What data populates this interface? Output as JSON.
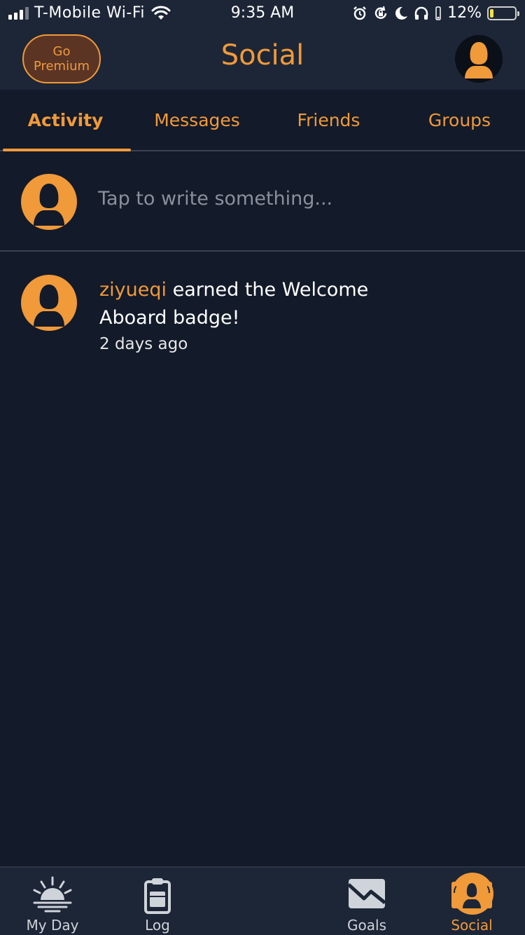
{
  "status_bar": {
    "carrier": "T-Mobile Wi-Fi",
    "time": "9:35 AM",
    "battery_percent": "12%",
    "battery_level": 0.12,
    "icons": [
      "signal-icon",
      "wifi-icon",
      "alarm-icon",
      "rotation-lock-icon",
      "moon-icon",
      "headphones-icon",
      "battery-icon"
    ]
  },
  "header": {
    "premium_line1": "Go",
    "premium_line2": "Premium",
    "title": "Social"
  },
  "tabs": [
    {
      "label": "Activity",
      "active": true
    },
    {
      "label": "Messages",
      "active": false
    },
    {
      "label": "Friends",
      "active": false
    },
    {
      "label": "Groups",
      "active": false
    }
  ],
  "composer": {
    "placeholder": "Tap to write something..."
  },
  "feed": [
    {
      "user": "ziyueqi",
      "text": " earned the Welcome Aboard badge!",
      "time": "2 days ago"
    }
  ],
  "tabbar": {
    "items": [
      {
        "label": "My Day",
        "icon": "sunrise-icon",
        "active": false
      },
      {
        "label": "Log",
        "icon": "clipboard-icon",
        "active": false
      },
      {
        "label": "",
        "icon": "plus-icon",
        "active": false
      },
      {
        "label": "Goals",
        "icon": "chart-icon",
        "active": false
      },
      {
        "label": "Social",
        "icon": "people-icon",
        "active": true
      }
    ]
  },
  "colors": {
    "accent": "#f09a3a",
    "background": "#131a29",
    "header": "#1d2637"
  }
}
